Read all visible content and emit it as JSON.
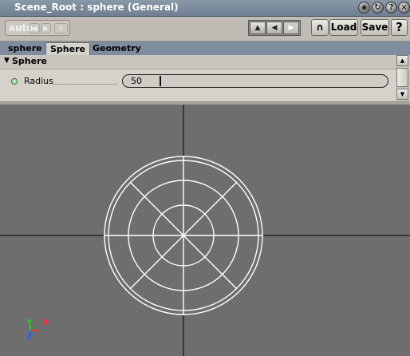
{
  "window": {
    "title": "Scene_Root : sphere (General)",
    "buttons": [
      "eye-icon",
      "recycle-icon",
      "help-icon",
      "close-icon"
    ]
  },
  "toolbar": {
    "auto_label": "auto",
    "load_label": "Load",
    "save_label": "Save",
    "help_label": "?"
  },
  "tabs": [
    {
      "label": "sphere",
      "active": false
    },
    {
      "label": "Sphere",
      "active": true
    },
    {
      "label": "Geometry",
      "active": false
    }
  ],
  "section": {
    "title": "Sphere",
    "params": [
      {
        "label": "Radius",
        "value": "50"
      }
    ]
  },
  "viewport": {
    "axis_x_label": "X",
    "axis_y_label": "Y",
    "axis_z_label": "Z",
    "colors": {
      "x": "#ff2b2b",
      "y": "#1fd11f",
      "z": "#2a5cff",
      "wire": "#ffffff",
      "grid": "#000000",
      "background": "#6e6e6e"
    }
  }
}
